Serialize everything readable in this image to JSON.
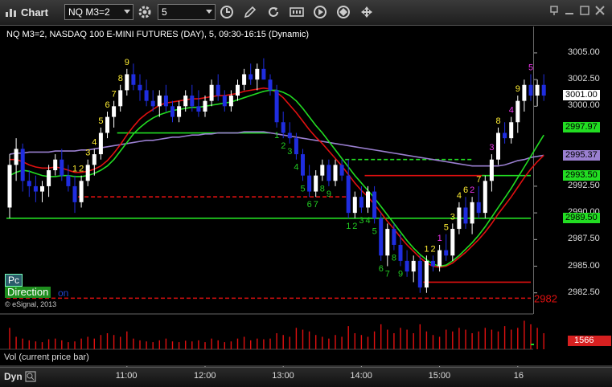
{
  "window": {
    "title": "Chart"
  },
  "toolbar": {
    "symbol": "NQ M3=2",
    "interval": "5",
    "icons": [
      "settings-icon",
      "clock-icon",
      "pencil-icon",
      "refresh-icon",
      "data-icon",
      "play-icon",
      "layout-icon"
    ]
  },
  "chart_info": "NQ M3=2, NASDAQ 100 E-MINI FUTURES (DAY), 5, 09:30-16:15 (Dynamic)",
  "labels": {
    "pc": "Pc",
    "direction": "Direction",
    "direction_suffix": "on",
    "copyright": "© eSignal, 2013",
    "vol_panel": "Vol (current price bar)",
    "dyn": "Dyn",
    "level_2982": "2982"
  },
  "colors": {
    "up": "#ffffff",
    "down": "#1f2de0",
    "ma_red": "#e01010",
    "ma_green": "#22dd22",
    "ma_purple": "#9a7fd0",
    "count_yellow": "#ffee33",
    "count_green": "#22cc22",
    "count_magenta": "#ee33ee"
  },
  "chart_data": {
    "type": "candlestick",
    "x_tick_labels": [
      "11:00",
      "12:00",
      "13:00",
      "14:00",
      "15:00",
      "16"
    ],
    "ylim": [
      2981.2,
      3006.8
    ],
    "y_ticks": [
      3005.0,
      3002.5,
      3000.0,
      2992.5,
      2990.0,
      2987.5,
      2985.0,
      2982.5
    ],
    "price_tags": [
      {
        "value": 3001.0,
        "label": "3001.00",
        "bg": "#ffffff",
        "fg": "#000000"
      },
      {
        "value": 2997.97,
        "label": "2997.97",
        "bg": "#22dd22",
        "fg": "#000000"
      },
      {
        "value": 2995.37,
        "label": "2995.37",
        "bg": "#9a7fd0",
        "fg": "#000000"
      },
      {
        "value": 2993.5,
        "label": "2993.50",
        "bg": "#22dd22",
        "fg": "#000000"
      },
      {
        "value": 2989.5,
        "label": "2989.50",
        "bg": "#22dd22",
        "fg": "#000000"
      }
    ],
    "candles": [
      [
        2990.5,
        2995.5,
        2989.5,
        2994.5
      ],
      [
        2994.5,
        2997.0,
        2993.0,
        2996.0
      ],
      [
        2996.0,
        2996.5,
        2992.0,
        2993.0
      ],
      [
        2993.0,
        2994.0,
        2991.5,
        2992.5
      ],
      [
        2992.5,
        2993.5,
        2991.0,
        2992.0
      ],
      [
        2992.0,
        2993.0,
        2991.0,
        2992.5
      ],
      [
        2992.5,
        2994.5,
        2991.5,
        2994.0
      ],
      [
        2994.0,
        2995.5,
        2993.5,
        2995.0
      ],
      [
        2995.0,
        2996.0,
        2993.0,
        2993.5
      ],
      [
        2993.5,
        2994.5,
        2992.0,
        2992.5
      ],
      [
        2992.5,
        2993.5,
        2990.0,
        2991.0
      ],
      [
        2991.0,
        2993.5,
        2990.5,
        2993.0
      ],
      [
        2993.0,
        2995.0,
        2992.5,
        2994.5
      ],
      [
        2994.5,
        2996.0,
        2993.5,
        2995.5
      ],
      [
        2995.5,
        2998.0,
        2995.0,
        2997.5
      ],
      [
        2997.5,
        2999.5,
        2997.0,
        2999.0
      ],
      [
        2999.0,
        3000.5,
        2998.0,
        3000.0
      ],
      [
        3000.0,
        3002.0,
        2999.5,
        3001.5
      ],
      [
        3001.5,
        3003.5,
        3001.0,
        3003.0
      ],
      [
        3003.0,
        3004.0,
        3001.5,
        3002.0
      ],
      [
        3002.0,
        3003.0,
        3000.5,
        3001.5
      ],
      [
        3001.5,
        3002.5,
        3000.0,
        3000.5
      ],
      [
        3000.5,
        3001.5,
        2999.5,
        3000.0
      ],
      [
        3000.0,
        3001.5,
        2999.0,
        3001.0
      ],
      [
        3001.0,
        3002.0,
        2999.5,
        3000.0
      ],
      [
        3000.0,
        3000.5,
        2998.5,
        2999.0
      ],
      [
        2999.0,
        3000.5,
        2998.5,
        3000.0
      ],
      [
        3000.0,
        3001.5,
        2999.5,
        3001.0
      ],
      [
        3001.0,
        3002.0,
        2999.5,
        3000.0
      ],
      [
        3000.0,
        3001.5,
        2999.0,
        2999.5
      ],
      [
        2999.5,
        3001.0,
        2999.0,
        3000.5
      ],
      [
        3000.5,
        3002.5,
        3000.0,
        3002.0
      ],
      [
        3002.0,
        3003.0,
        3000.5,
        3001.0
      ],
      [
        3001.0,
        3001.5,
        2999.5,
        3000.0
      ],
      [
        3000.0,
        3001.5,
        2999.5,
        3001.0
      ],
      [
        3001.0,
        3002.5,
        3000.5,
        3002.0
      ],
      [
        3002.0,
        3003.5,
        3001.5,
        3003.0
      ],
      [
        3003.0,
        3004.0,
        3002.0,
        3002.5
      ],
      [
        3002.5,
        3004.0,
        3001.5,
        3003.5
      ],
      [
        3003.5,
        3004.5,
        3002.5,
        3002.5
      ],
      [
        3002.5,
        3003.0,
        3001.0,
        3001.5
      ],
      [
        3001.5,
        3002.0,
        2998.0,
        2998.5
      ],
      [
        2998.5,
        2999.5,
        2997.0,
        2997.5
      ],
      [
        2997.5,
        2998.5,
        2996.5,
        2997.0
      ],
      [
        2997.0,
        2997.5,
        2995.0,
        2995.5
      ],
      [
        2995.5,
        2996.0,
        2993.0,
        2993.5
      ],
      [
        2993.5,
        2994.5,
        2991.5,
        2992.0
      ],
      [
        2992.0,
        2994.0,
        2991.5,
        2993.5
      ],
      [
        2993.5,
        2995.0,
        2993.0,
        2994.5
      ],
      [
        2994.5,
        2995.0,
        2992.5,
        2993.0
      ],
      [
        2993.0,
        2995.0,
        2992.5,
        2994.5
      ],
      [
        2994.5,
        2995.0,
        2993.0,
        2993.5
      ],
      [
        2993.5,
        2995.0,
        2989.5,
        2990.0
      ],
      [
        2990.0,
        2992.0,
        2989.5,
        2991.5
      ],
      [
        2991.5,
        2992.5,
        2990.0,
        2990.5
      ],
      [
        2990.5,
        2992.5,
        2990.0,
        2992.0
      ],
      [
        2992.0,
        2992.5,
        2989.0,
        2989.5
      ],
      [
        2989.5,
        2990.0,
        2985.5,
        2986.0
      ],
      [
        2986.0,
        2989.0,
        2985.0,
        2988.5
      ],
      [
        2988.5,
        2989.0,
        2986.5,
        2987.0
      ],
      [
        2987.0,
        2988.0,
        2985.0,
        2985.5
      ],
      [
        2985.5,
        2986.5,
        2984.0,
        2984.5
      ],
      [
        2984.5,
        2986.0,
        2983.5,
        2985.5
      ],
      [
        2985.5,
        2986.0,
        2982.5,
        2983.0
      ],
      [
        2983.0,
        2986.0,
        2982.5,
        2985.5
      ],
      [
        2985.5,
        2986.0,
        2984.5,
        2985.0
      ],
      [
        2985.0,
        2987.0,
        2984.5,
        2986.5
      ],
      [
        2986.5,
        2988.0,
        2985.5,
        2986.0
      ],
      [
        2986.0,
        2989.0,
        2985.5,
        2988.5
      ],
      [
        2988.5,
        2991.0,
        2988.0,
        2990.5
      ],
      [
        2990.5,
        2991.5,
        2988.5,
        2989.0
      ],
      [
        2989.0,
        2991.5,
        2988.0,
        2991.0
      ],
      [
        2991.0,
        2992.5,
        2989.5,
        2990.0
      ],
      [
        2990.0,
        2993.5,
        2989.5,
        2993.0
      ],
      [
        2993.0,
        2995.5,
        2992.0,
        2995.0
      ],
      [
        2995.0,
        2998.0,
        2994.5,
        2997.5
      ],
      [
        2997.5,
        2998.5,
        2996.5,
        2997.0
      ],
      [
        2997.0,
        2999.0,
        2996.5,
        2998.5
      ],
      [
        2998.5,
        3001.0,
        2997.5,
        3000.5
      ],
      [
        3000.5,
        3002.5,
        2999.5,
        3002.0
      ],
      [
        3002.0,
        3003.0,
        3000.5,
        3001.0
      ],
      [
        3001.0,
        3002.5,
        3000.0,
        3002.0
      ],
      [
        3002.0,
        3003.0,
        3000.5,
        3001.0
      ]
    ],
    "ma_red": [
      2995.0,
      2995.0,
      2994.8,
      2994.5,
      2994.3,
      2994.2,
      2994.2,
      2994.3,
      2994.2,
      2994.0,
      2993.8,
      2993.8,
      2993.9,
      2994.1,
      2994.4,
      2994.9,
      2995.6,
      2996.4,
      2997.3,
      2998.1,
      2998.8,
      2999.3,
      2999.7,
      3000.1,
      3000.3,
      3000.4,
      3000.5,
      3000.6,
      3000.7,
      3000.7,
      3000.8,
      3000.9,
      3001.0,
      3001.0,
      3001.1,
      3001.2,
      3001.4,
      3001.5,
      3001.6,
      3001.7,
      3001.6,
      3001.3,
      3000.8,
      3000.1,
      2999.4,
      2998.6,
      2997.8,
      2997.1,
      2996.5,
      2995.8,
      2995.1,
      2994.4,
      2993.6,
      2992.8,
      2992.1,
      2991.5,
      2990.8,
      2990.0,
      2989.2,
      2988.5,
      2987.7,
      2987.0,
      2986.4,
      2985.8,
      2985.3,
      2985.0,
      2984.9,
      2985.0,
      2985.3,
      2985.8,
      2986.3,
      2986.9,
      2987.5,
      2988.2,
      2989.0,
      2989.9,
      2990.7,
      2991.5,
      2992.4,
      2993.3,
      2994.1,
      2994.8,
      2995.4
    ],
    "ma_green": [
      2993.5,
      2993.8,
      2994.0,
      2993.9,
      2993.7,
      2993.5,
      2993.4,
      2993.4,
      2993.5,
      2993.5,
      2993.4,
      2993.4,
      2993.5,
      2993.7,
      2994.0,
      2994.4,
      2995.0,
      2995.8,
      2996.6,
      2997.4,
      2998.0,
      2998.5,
      2998.9,
      2999.2,
      2999.4,
      2999.6,
      2999.7,
      2999.8,
      2999.9,
      2999.9,
      3000.0,
      3000.1,
      3000.2,
      3000.3,
      3000.4,
      3000.6,
      3000.8,
      3001.0,
      3001.2,
      3001.4,
      3001.5,
      3001.5,
      3001.3,
      3001.0,
      3000.5,
      2999.8,
      2999.0,
      2998.2,
      2997.5,
      2996.7,
      2995.9,
      2995.1,
      2994.3,
      2993.5,
      2992.8,
      2992.1,
      2991.4,
      2990.6,
      2989.8,
      2989.0,
      2988.2,
      2987.4,
      2986.7,
      2986.1,
      2985.6,
      2985.2,
      2985.0,
      2985.1,
      2985.5,
      2986.0,
      2986.6,
      2987.2,
      2987.9,
      2988.7,
      2989.6,
      2990.5,
      2991.4,
      2992.3,
      2993.3,
      2994.3,
      2995.3,
      2996.3,
      2997.3
    ],
    "ma_purple": [
      2995.5,
      2995.6,
      2995.6,
      2995.7,
      2995.7,
      2995.7,
      2995.7,
      2995.8,
      2995.8,
      2995.8,
      2995.8,
      2995.9,
      2995.9,
      2996.0,
      2996.1,
      2996.2,
      2996.3,
      2996.4,
      2996.5,
      2996.6,
      2996.7,
      2996.8,
      2996.8,
      2996.9,
      2997.0,
      2997.1,
      2997.1,
      2997.2,
      2997.3,
      2997.3,
      2997.4,
      2997.4,
      2997.5,
      2997.5,
      2997.5,
      2997.5,
      2997.6,
      2997.6,
      2997.6,
      2997.6,
      2997.5,
      2997.4,
      2997.3,
      2997.2,
      2997.1,
      2997.0,
      2996.9,
      2996.8,
      2996.7,
      2996.6,
      2996.5,
      2996.4,
      2996.3,
      2996.2,
      2996.1,
      2996.0,
      2995.9,
      2995.8,
      2995.7,
      2995.6,
      2995.5,
      2995.4,
      2995.3,
      2995.2,
      2995.1,
      2995.0,
      2994.9,
      2994.8,
      2994.7,
      2994.6,
      2994.5,
      2994.4,
      2994.4,
      2994.4,
      2994.4,
      2994.4,
      2994.5,
      2994.7,
      2994.9,
      2995.0,
      2995.2,
      2995.3,
      2995.4
    ],
    "hlines": [
      {
        "y": 2989.5,
        "from": 0,
        "to": 82,
        "color": "#22dd22",
        "dash": false
      },
      {
        "y": 2991.5,
        "from": 11,
        "to": 52,
        "color": "#e01010",
        "dash": true
      },
      {
        "y": 2997.5,
        "from": 17,
        "to": 40,
        "color": "#22dd22",
        "dash": false
      },
      {
        "y": 2995.0,
        "from": 52,
        "to": 71,
        "color": "#22dd22",
        "dash": true
      },
      {
        "y": 2993.5,
        "from": 55,
        "to": 73,
        "color": "#e01010",
        "dash": false
      },
      {
        "y": 2993.5,
        "from": 73,
        "to": 82,
        "color": "#22dd22",
        "dash": false
      },
      {
        "y": 2983.5,
        "from": 64,
        "to": 82,
        "color": "#e01010",
        "dash": false
      },
      {
        "y": 2982.0,
        "from": 0,
        "to": 82,
        "color": "#e01010",
        "dash": true
      }
    ],
    "counts": [
      {
        "bar": 10,
        "t": "1",
        "c": "count_yellow",
        "pos": "above"
      },
      {
        "bar": 11,
        "t": "2",
        "c": "count_yellow",
        "pos": "above"
      },
      {
        "bar": 12,
        "t": "3",
        "c": "count_yellow",
        "pos": "above"
      },
      {
        "bar": 13,
        "t": "4",
        "c": "count_yellow",
        "pos": "above"
      },
      {
        "bar": 14,
        "t": "5",
        "c": "count_yellow",
        "pos": "above"
      },
      {
        "bar": 15,
        "t": "6",
        "c": "count_yellow",
        "pos": "above"
      },
      {
        "bar": 16,
        "t": "7",
        "c": "count_yellow",
        "pos": "above"
      },
      {
        "bar": 17,
        "t": "8",
        "c": "count_yellow",
        "pos": "above"
      },
      {
        "bar": 18,
        "t": "9",
        "c": "count_yellow",
        "pos": "above"
      },
      {
        "bar": 41,
        "t": "1",
        "c": "count_green",
        "pos": "below"
      },
      {
        "bar": 42,
        "t": "2",
        "c": "count_green",
        "pos": "below"
      },
      {
        "bar": 43,
        "t": "3",
        "c": "count_green",
        "pos": "below"
      },
      {
        "bar": 44,
        "t": "4",
        "c": "count_green",
        "pos": "below"
      },
      {
        "bar": 45,
        "t": "5",
        "c": "count_green",
        "pos": "below"
      },
      {
        "bar": 46,
        "t": "6",
        "c": "count_green",
        "pos": "below"
      },
      {
        "bar": 47,
        "t": "7",
        "c": "count_green",
        "pos": "below"
      },
      {
        "bar": 48,
        "t": "8",
        "c": "count_green",
        "pos": "below"
      },
      {
        "bar": 49,
        "t": "9",
        "c": "count_green",
        "pos": "below"
      },
      {
        "bar": 52,
        "t": "1",
        "c": "count_green",
        "pos": "below"
      },
      {
        "bar": 53,
        "t": "2",
        "c": "count_green",
        "pos": "below"
      },
      {
        "bar": 54,
        "t": "3",
        "c": "count_green",
        "pos": "below"
      },
      {
        "bar": 55,
        "t": "4",
        "c": "count_green",
        "pos": "below"
      },
      {
        "bar": 56,
        "t": "5",
        "c": "count_green",
        "pos": "below"
      },
      {
        "bar": 57,
        "t": "6",
        "c": "count_green",
        "pos": "below"
      },
      {
        "bar": 58,
        "t": "7",
        "c": "count_green",
        "pos": "below"
      },
      {
        "bar": 59,
        "t": "8",
        "c": "count_green",
        "pos": "below"
      },
      {
        "bar": 60,
        "t": "9",
        "c": "count_green",
        "pos": "below"
      },
      {
        "bar": 64,
        "t": "1",
        "c": "count_yellow",
        "pos": "above"
      },
      {
        "bar": 65,
        "t": "2",
        "c": "count_yellow",
        "pos": "above"
      },
      {
        "bar": 66,
        "t": "1",
        "c": "count_magenta",
        "pos": "above"
      },
      {
        "bar": 67,
        "t": "5",
        "c": "count_yellow",
        "pos": "above"
      },
      {
        "bar": 68,
        "t": "3",
        "c": "count_yellow",
        "pos": "above"
      },
      {
        "bar": 69,
        "t": "4",
        "c": "count_yellow",
        "pos": "above"
      },
      {
        "bar": 70,
        "t": "6",
        "c": "count_yellow",
        "pos": "above"
      },
      {
        "bar": 71,
        "t": "2",
        "c": "count_magenta",
        "pos": "above"
      },
      {
        "bar": 72,
        "t": "7",
        "c": "count_yellow",
        "pos": "above"
      },
      {
        "bar": 74,
        "t": "3",
        "c": "count_magenta",
        "pos": "above"
      },
      {
        "bar": 75,
        "t": "8",
        "c": "count_yellow",
        "pos": "above"
      },
      {
        "bar": 77,
        "t": "4",
        "c": "count_magenta",
        "pos": "above"
      },
      {
        "bar": 78,
        "t": "9",
        "c": "count_yellow",
        "pos": "above"
      },
      {
        "bar": 80,
        "t": "5",
        "c": "count_magenta",
        "pos": "above"
      }
    ],
    "volume": {
      "last": 1566,
      "last_label": "1566",
      "values": [
        60,
        35,
        30,
        25,
        22,
        20,
        28,
        30,
        25,
        20,
        22,
        30,
        35,
        30,
        40,
        45,
        40,
        35,
        50,
        30,
        25,
        22,
        20,
        25,
        30,
        22,
        20,
        24,
        22,
        25,
        20,
        30,
        25,
        20,
        22,
        30,
        35,
        25,
        30,
        28,
        30,
        45,
        40,
        35,
        60,
        55,
        50,
        40,
        35,
        30,
        40,
        35,
        65,
        45,
        40,
        35,
        50,
        70,
        55,
        45,
        60,
        55,
        45,
        70,
        50,
        40,
        35,
        55,
        50,
        60,
        55,
        45,
        50,
        60,
        55,
        50,
        65,
        55,
        60,
        80,
        70,
        60,
        45
      ]
    }
  }
}
